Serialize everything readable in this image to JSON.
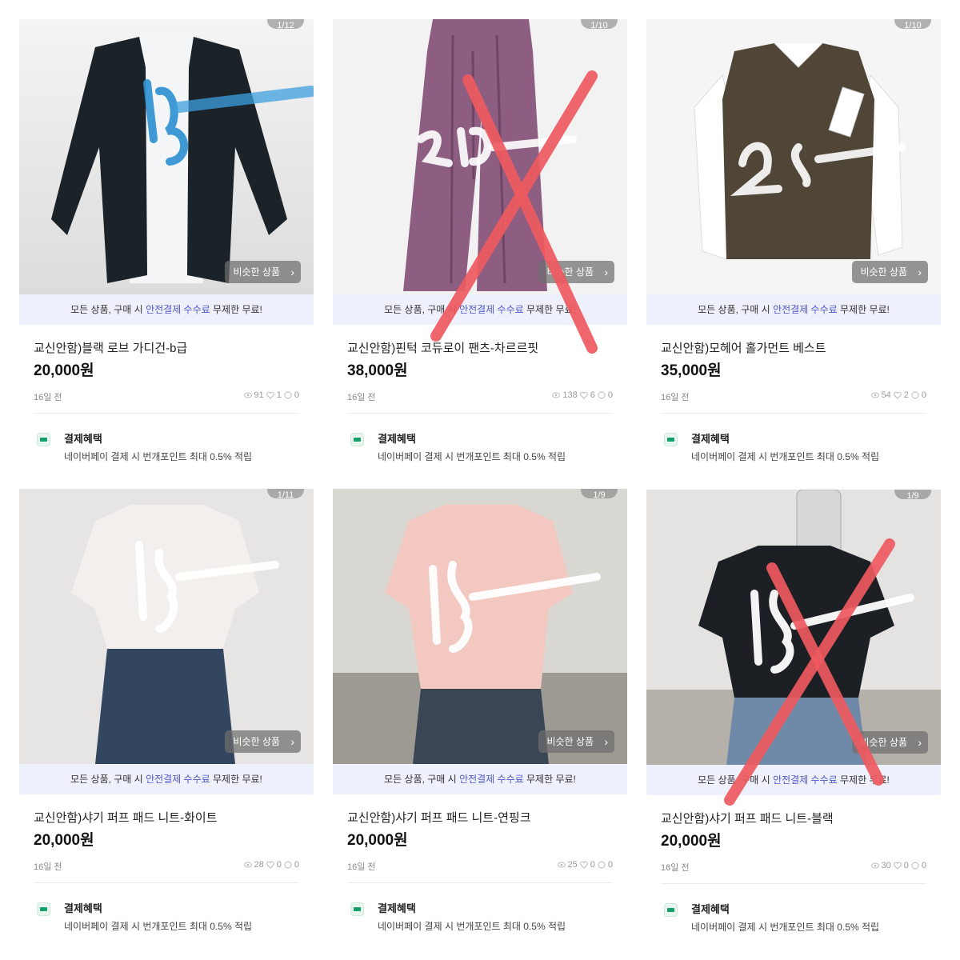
{
  "products": [
    {
      "counter": "1/12",
      "similar_label": "비슷한 상품",
      "promo": {
        "pre": "모든 상품, 구매 시 ",
        "highlight": "안전결제 수수료",
        "post": " 무제한 무료!"
      },
      "title": "교신안함)블랙 로브 가디건-b급",
      "price": "20,000원",
      "time": "16일 전",
      "views": "91",
      "likes": "1",
      "chats": "0",
      "benefit_title": "결제혜택",
      "benefit_desc": "네이버페이 결제 시 번개포인트 최대 0.5% 적립",
      "image_price_text": "15,-",
      "crossed_out": false
    },
    {
      "counter": "1/10",
      "similar_label": "비슷한 상품",
      "promo": {
        "pre": "모든 상품, 구매 시 ",
        "highlight": "안전결제 수수료",
        "post": " 무제한 무료!"
      },
      "title": "교신안함)핀턱 코듀로이 팬츠-차르르핏",
      "price": "38,000원",
      "time": "16일 전",
      "views": "138",
      "likes": "6",
      "chats": "0",
      "benefit_title": "결제혜택",
      "benefit_desc": "네이버페이 결제 시 번개포인트 최대 0.5% 적립",
      "image_price_text": "30,-",
      "crossed_out": true
    },
    {
      "counter": "1/10",
      "similar_label": "비슷한 상품",
      "promo": {
        "pre": "모든 상품, 구매 시 ",
        "highlight": "안전결제 수수료",
        "post": " 무제한 무료!"
      },
      "title": "교신안함)모헤어 홀가먼트 베스트",
      "price": "35,000원",
      "time": "16일 전",
      "views": "54",
      "likes": "2",
      "chats": "0",
      "benefit_title": "결제혜택",
      "benefit_desc": "네이버페이 결제 시 번개포인트 최대 0.5% 적립",
      "image_price_text": "28,-",
      "crossed_out": false
    },
    {
      "counter": "1/11",
      "similar_label": "비슷한 상품",
      "promo": {
        "pre": "모든 상품, 구매 시 ",
        "highlight": "안전결제 수수료",
        "post": " 무제한 무료!"
      },
      "title": "교신안함)샤기 퍼프 패드 니트-화이트",
      "price": "20,000원",
      "time": "16일 전",
      "views": "28",
      "likes": "0",
      "chats": "0",
      "benefit_title": "결제혜택",
      "benefit_desc": "네이버페이 결제 시 번개포인트 최대 0.5% 적립",
      "image_price_text": "15,-",
      "crossed_out": false
    },
    {
      "counter": "1/9",
      "similar_label": "비슷한 상품",
      "promo": {
        "pre": "모든 상품, 구매 시 ",
        "highlight": "안전결제 수수료",
        "post": " 무제한 무료!"
      },
      "title": "교신안함)샤기 퍼프 패드 니트-연핑크",
      "price": "20,000원",
      "time": "16일 전",
      "views": "25",
      "likes": "0",
      "chats": "0",
      "benefit_title": "결제혜택",
      "benefit_desc": "네이버페이 결제 시 번개포인트 최대 0.5% 적립",
      "image_price_text": "15,-",
      "crossed_out": false
    },
    {
      "counter": "1/9",
      "similar_label": "비슷한 상품",
      "promo": {
        "pre": "모든 상품, 구매 시 ",
        "highlight": "안전결제 수수료",
        "post": " 무제한 무료!"
      },
      "title": "교신안함)샤기 퍼프 패드 니트-블랙",
      "price": "20,000원",
      "time": "16일 전",
      "views": "30",
      "likes": "0",
      "chats": "0",
      "benefit_title": "결제혜택",
      "benefit_desc": "네이버페이 결제 시 번개포인트 최대 0.5% 적립",
      "image_price_text": "15,-",
      "crossed_out": true
    }
  ],
  "colors": {
    "promo_bg": "#eef0fb",
    "promo_highlight": "#4f5ac9",
    "cross_mark": "#ee5a5f",
    "npay_green": "#13a06a"
  }
}
